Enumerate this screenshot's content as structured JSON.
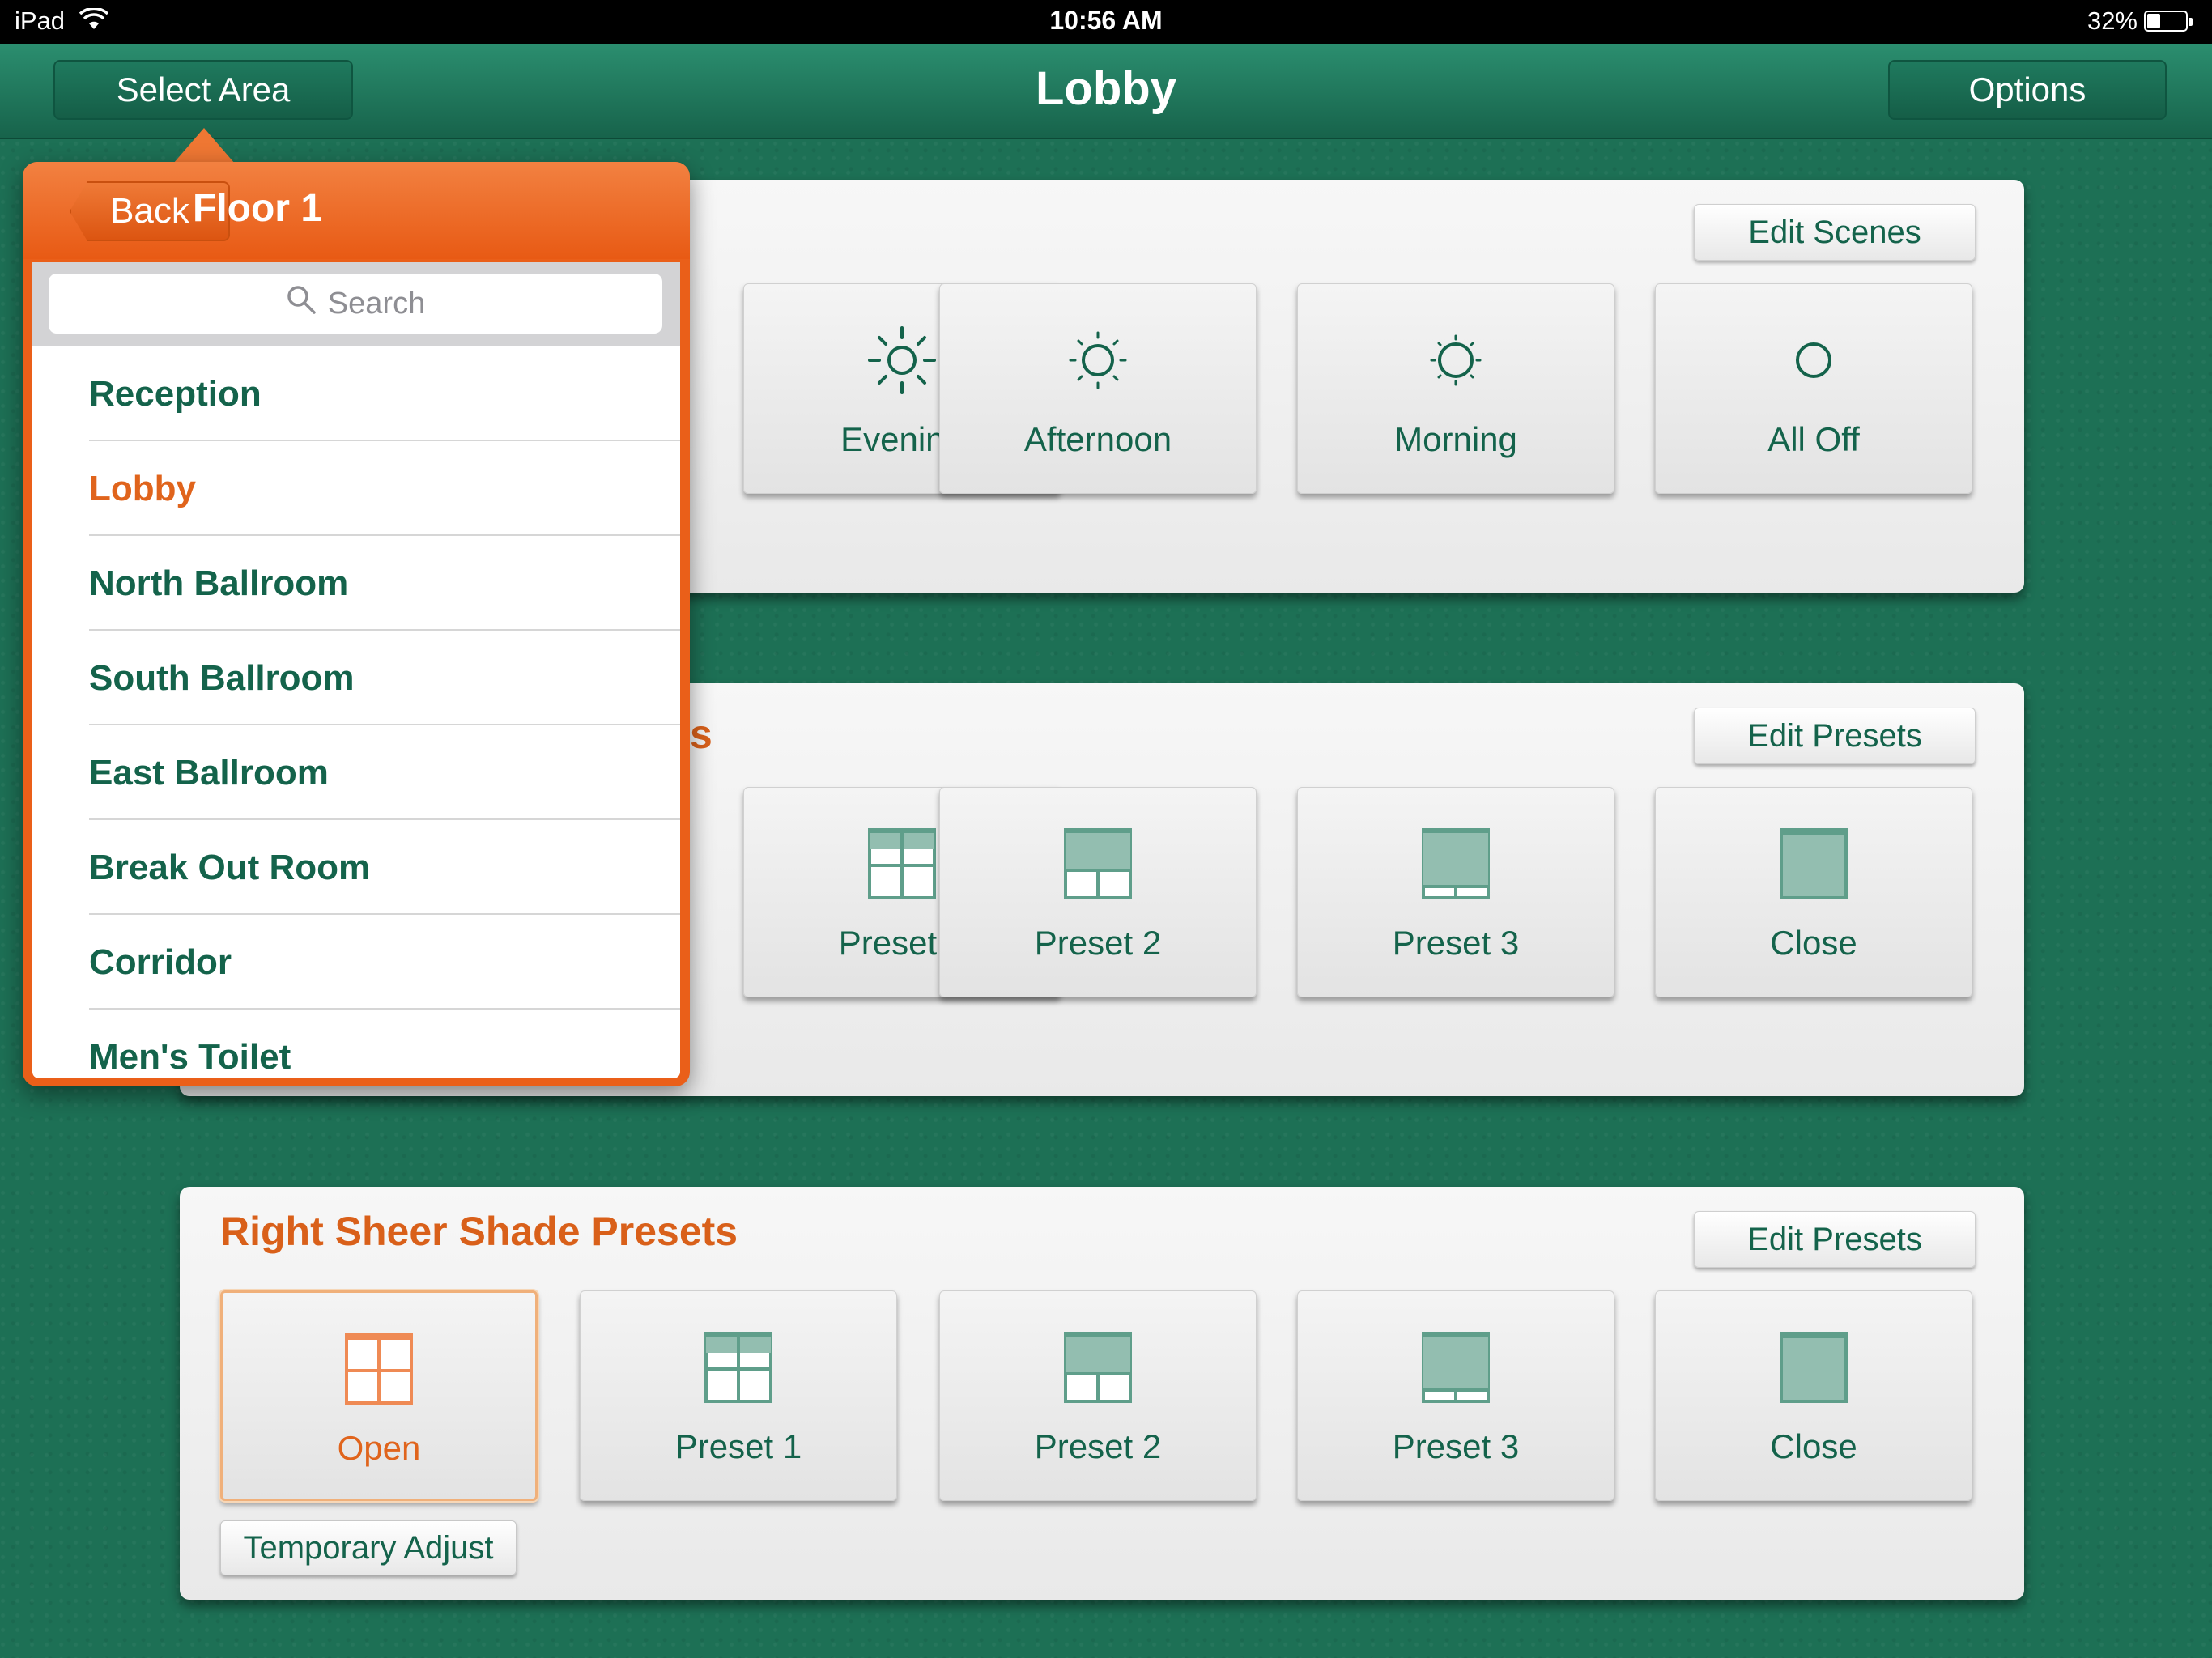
{
  "status_bar": {
    "device": "iPad",
    "time": "10:56 AM",
    "battery": "32%",
    "battery_level": 0.32
  },
  "nav": {
    "left_button": "Select Area",
    "title": "Lobby",
    "right_button": "Options"
  },
  "scenes_panel": {
    "edit_label": "Edit Scenes",
    "tiles": [
      {
        "label": "Evening",
        "icon": "sun-dim-icon"
      },
      {
        "label": "Afternoon",
        "icon": "sun-medium-icon"
      },
      {
        "label": "Morning",
        "icon": "sun-low-icon"
      },
      {
        "label": "All Off",
        "icon": "circle-off-icon"
      }
    ]
  },
  "left_shade_panel": {
    "title_visible": "s",
    "edit_label": "Edit Presets",
    "tiles": [
      {
        "label": "Preset 1",
        "icon": "shade-preset-1-icon"
      },
      {
        "label": "Preset 2",
        "icon": "shade-preset-2-icon"
      },
      {
        "label": "Preset 3",
        "icon": "shade-preset-3-icon"
      },
      {
        "label": "Close",
        "icon": "shade-closed-icon"
      }
    ]
  },
  "right_shade_panel": {
    "title": "Right Sheer Shade Presets",
    "edit_label": "Edit Presets",
    "temp_adjust": "Temporary Adjust",
    "tiles": [
      {
        "label": "Open",
        "icon": "shade-open-icon",
        "selected": true
      },
      {
        "label": "Preset 1",
        "icon": "shade-preset-1-icon"
      },
      {
        "label": "Preset 2",
        "icon": "shade-preset-2-icon"
      },
      {
        "label": "Preset 3",
        "icon": "shade-preset-3-icon"
      },
      {
        "label": "Close",
        "icon": "shade-closed-icon"
      }
    ]
  },
  "popover": {
    "back_label": "Back",
    "title": "Floor 1",
    "search_placeholder": "Search",
    "areas": [
      {
        "label": "Reception"
      },
      {
        "label": "Lobby",
        "active": true
      },
      {
        "label": "North Ballroom"
      },
      {
        "label": "South Ballroom"
      },
      {
        "label": "East Ballroom"
      },
      {
        "label": "Break Out Room"
      },
      {
        "label": "Corridor"
      },
      {
        "label": "Men's Toilet"
      }
    ]
  },
  "colors": {
    "brand_green": "#14634b",
    "accent_orange": "#e85a14",
    "background": "#1d7055"
  }
}
